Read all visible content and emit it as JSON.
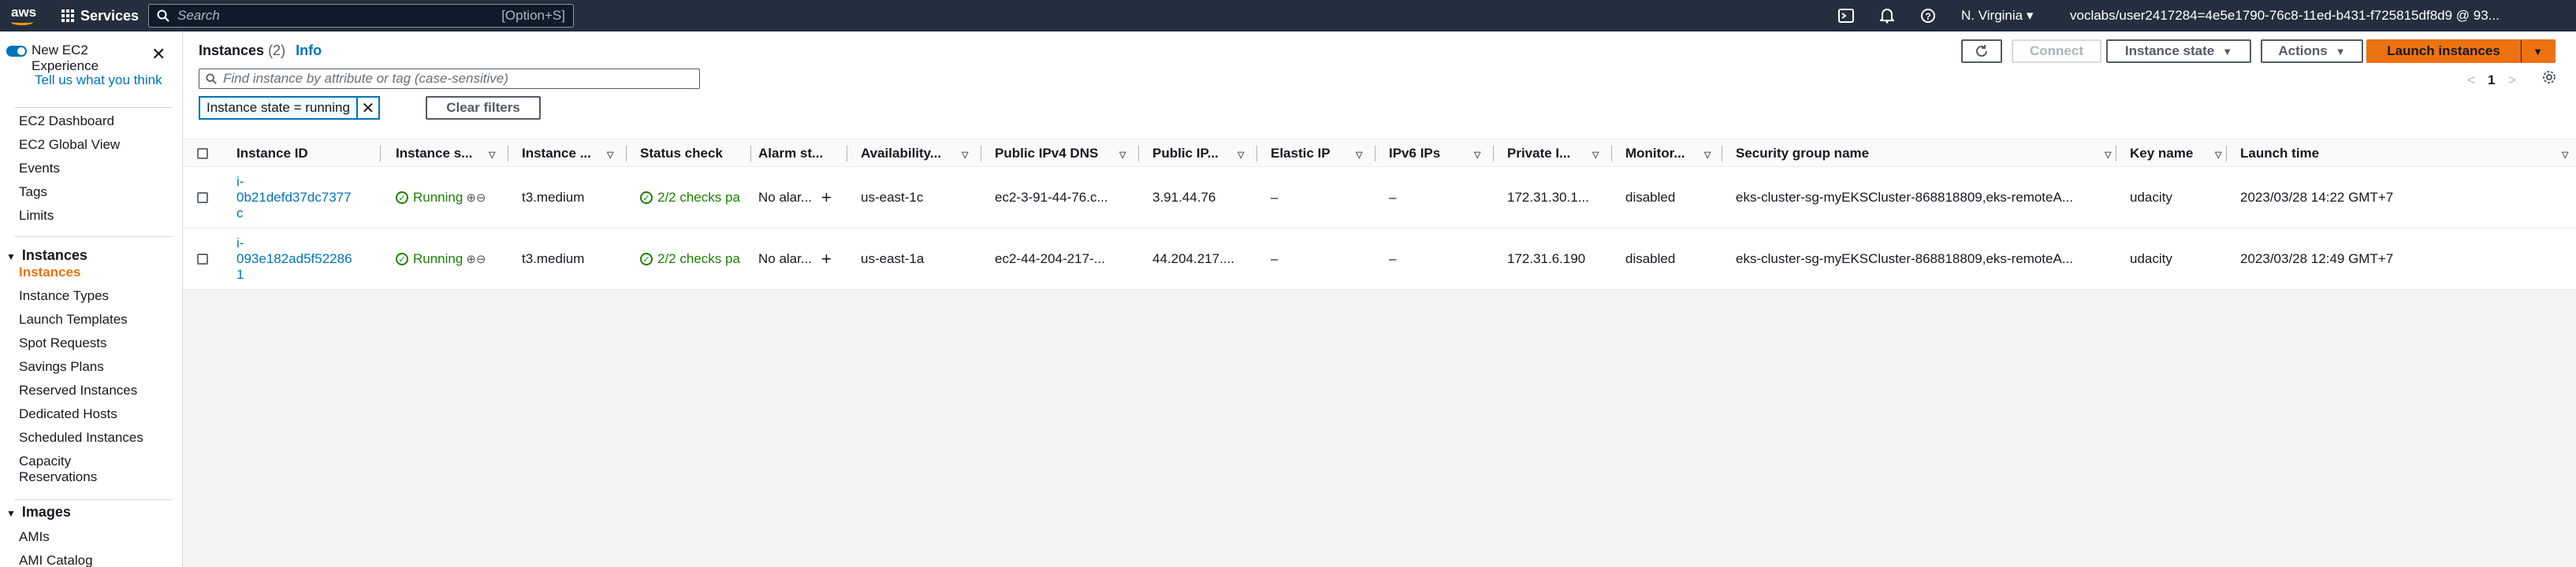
{
  "topnav": {
    "logo": "aws",
    "services": "Services",
    "search_placeholder": "Search",
    "search_shortcut": "[Option+S]",
    "region": "N. Virginia ▾",
    "account": "voclabs/user2417284=4e5e1790-76c8-11ed-b431-f725815df8d9 @ 93..."
  },
  "sidebar": {
    "new_exp_label": "New EC2 Experience",
    "tell_us": "Tell us what you think",
    "top_items": [
      "EC2 Dashboard",
      "EC2 Global View",
      "Events",
      "Tags",
      "Limits"
    ],
    "instances_section": "Instances",
    "instances_items": [
      "Instances",
      "Instance Types",
      "Launch Templates",
      "Spot Requests",
      "Savings Plans",
      "Reserved Instances",
      "Dedicated Hosts",
      "Scheduled Instances",
      "Capacity Reservations"
    ],
    "images_section": "Images",
    "images_items": [
      "AMIs",
      "AMI Catalog"
    ]
  },
  "header": {
    "title": "Instances",
    "count": "(2)",
    "info": "Info",
    "connect": "Connect",
    "instance_state": "Instance state",
    "actions": "Actions",
    "launch": "Launch instances",
    "page": "1"
  },
  "filter": {
    "placeholder": "Find instance by attribute or tag (case-sensitive)",
    "chip": "Instance state = running",
    "clear": "Clear filters"
  },
  "columns": [
    "Instance ID",
    "Instance s...",
    "Instance ...",
    "Status check",
    "Alarm st...",
    "Availability...",
    "Public IPv4 DNS",
    "Public IP...",
    "Elastic IP",
    "IPv6 IPs",
    "Private I...",
    "Monitor...",
    "Security group name",
    "Key name",
    "Launch time"
  ],
  "rows": [
    {
      "id_line1": "i-",
      "id_line2": "0b21defd37dc7377",
      "id_line3": "c",
      "state": "Running",
      "type": "t3.medium",
      "status": "2/2 checks pa",
      "alarm": "No alar...",
      "az": "us-east-1c",
      "dns": "ec2-3-91-44-76.c...",
      "public_ip": "3.91.44.76",
      "elastic_ip": "–",
      "ipv6": "–",
      "private_ip": "172.31.30.1...",
      "monitoring": "disabled",
      "sg": "eks-cluster-sg-myEKSCluster-868818809,eks-remoteA...",
      "key": "udacity",
      "launch": "2023/03/28 14:22 GMT+7"
    },
    {
      "id_line1": "i-",
      "id_line2": "093e182ad5f52286",
      "id_line3": "1",
      "state": "Running",
      "type": "t3.medium",
      "status": "2/2 checks pa",
      "alarm": "No alar...",
      "az": "us-east-1a",
      "dns": "ec2-44-204-217-...",
      "public_ip": "44.204.217....",
      "elastic_ip": "–",
      "ipv6": "–",
      "private_ip": "172.31.6.190",
      "monitoring": "disabled",
      "sg": "eks-cluster-sg-myEKSCluster-868818809,eks-remoteA...",
      "key": "udacity",
      "launch": "2023/03/28 12:49 GMT+7"
    }
  ],
  "colors": {
    "nav": "#232f3e",
    "accent": "#ec7211",
    "link": "#0073bb",
    "success": "#1d8102"
  }
}
